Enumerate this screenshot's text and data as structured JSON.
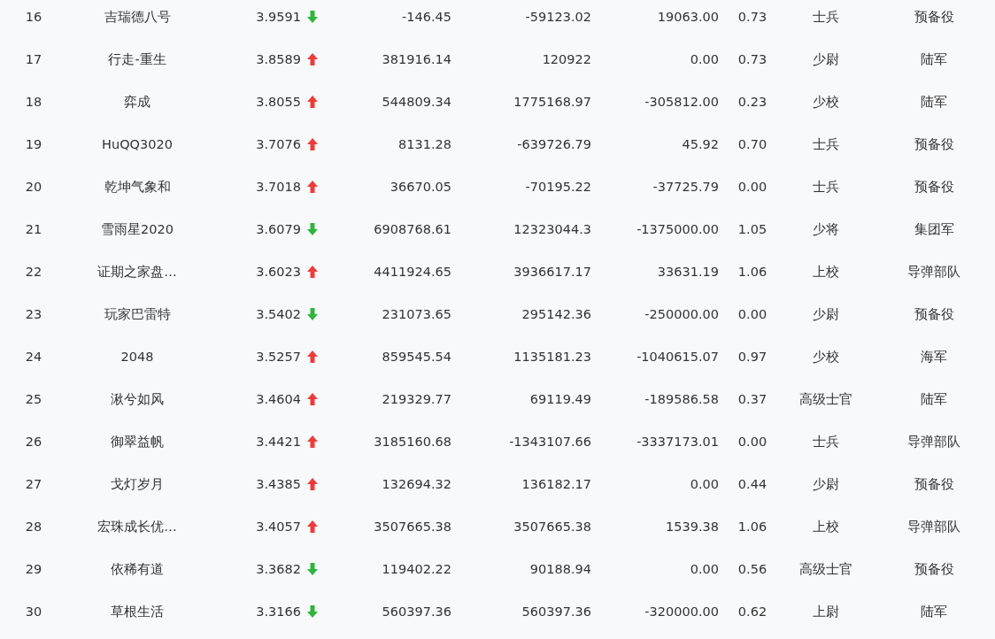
{
  "table": {
    "rows": [
      {
        "column_1": "16",
        "column_2": "吉瑞德八号",
        "column_3": "3.9591",
        "rising": false,
        "column_4": "-146.45",
        "column_5": "-59123.02",
        "column_6": "19063.00",
        "column_7": "0.73",
        "column_8": "士兵",
        "column_9": "预备役"
      },
      {
        "column_1": "17",
        "column_2": "行走-重生",
        "column_3": "3.8589",
        "rising": true,
        "column_4": "381916.14",
        "column_5": "120922",
        "column_6": "0.00",
        "column_7": "0.73",
        "column_8": "少尉",
        "column_9": "陆军"
      },
      {
        "column_1": "18",
        "column_2": "弈成",
        "column_3": "3.8055",
        "rising": true,
        "column_4": "544809.34",
        "column_5": "1775168.97",
        "column_6": "-305812.00",
        "column_7": "0.23",
        "column_8": "少校",
        "column_9": "陆军"
      },
      {
        "column_1": "19",
        "column_2": "HuQQ3020",
        "column_3": "3.7076",
        "rising": true,
        "column_4": "8131.28",
        "column_5": "-639726.79",
        "column_6": "45.92",
        "column_7": "0.70",
        "column_8": "士兵",
        "column_9": "预备役"
      },
      {
        "column_1": "20",
        "column_2": "乾坤气象和",
        "column_3": "3.7018",
        "rising": true,
        "column_4": "36670.05",
        "column_5": "-70195.22",
        "column_6": "-37725.79",
        "column_7": "0.00",
        "column_8": "士兵",
        "column_9": "预备役"
      },
      {
        "column_1": "21",
        "column_2": "雪雨星2020",
        "column_3": "3.6079",
        "rising": false,
        "column_4": "6908768.61",
        "column_5": "12323044.3",
        "column_6": "-1375000.00",
        "column_7": "1.05",
        "column_8": "少将",
        "column_9": "集团军"
      },
      {
        "column_1": "22",
        "column_2": "证期之家盘…",
        "column_3": "3.6023",
        "rising": true,
        "column_4": "4411924.65",
        "column_5": "3936617.17",
        "column_6": "33631.19",
        "column_7": "1.06",
        "column_8": "上校",
        "column_9": "导弹部队"
      },
      {
        "column_1": "23",
        "column_2": "玩家巴雷特",
        "column_3": "3.5402",
        "rising": false,
        "column_4": "231073.65",
        "column_5": "295142.36",
        "column_6": "-250000.00",
        "column_7": "0.00",
        "column_8": "少尉",
        "column_9": "预备役"
      },
      {
        "column_1": "24",
        "column_2": "2048",
        "column_3": "3.5257",
        "rising": true,
        "column_4": "859545.54",
        "column_5": "1135181.23",
        "column_6": "-1040615.07",
        "column_7": "0.97",
        "column_8": "少校",
        "column_9": "海军"
      },
      {
        "column_1": "25",
        "column_2": "湫兮如风",
        "column_3": "3.4604",
        "rising": true,
        "column_4": "219329.77",
        "column_5": "69119.49",
        "column_6": "-189586.58",
        "column_7": "0.37",
        "column_8": "高级士官",
        "column_9": "陆军"
      },
      {
        "column_1": "26",
        "column_2": "御翠益帆",
        "column_3": "3.4421",
        "rising": true,
        "column_4": "3185160.68",
        "column_5": "-1343107.66",
        "column_6": "-3337173.01",
        "column_7": "0.00",
        "column_8": "士兵",
        "column_9": "导弹部队"
      },
      {
        "column_1": "27",
        "column_2": "戈灯岁月",
        "column_3": "3.4385",
        "rising": true,
        "column_4": "132694.32",
        "column_5": "136182.17",
        "column_6": "0.00",
        "column_7": "0.44",
        "column_8": "少尉",
        "column_9": "预备役"
      },
      {
        "column_1": "28",
        "column_2": "宏珠成长优…",
        "column_3": "3.4057",
        "rising": true,
        "column_4": "3507665.38",
        "column_5": "3507665.38",
        "column_6": "1539.38",
        "column_7": "1.06",
        "column_8": "上校",
        "column_9": "导弹部队"
      },
      {
        "column_1": "29",
        "column_2": "依稀有道",
        "column_3": "3.3682",
        "rising": false,
        "column_4": "119402.22",
        "column_5": "90188.94",
        "column_6": "0.00",
        "column_7": "0.56",
        "column_8": "高级士官",
        "column_9": "预备役"
      },
      {
        "column_1": "30",
        "column_2": "草根生活",
        "column_3": "3.3166",
        "rising": false,
        "column_4": "560397.36",
        "column_5": "560397.36",
        "column_6": "-320000.00",
        "column_7": "0.62",
        "column_8": "上尉",
        "column_9": "陆军"
      }
    ]
  }
}
